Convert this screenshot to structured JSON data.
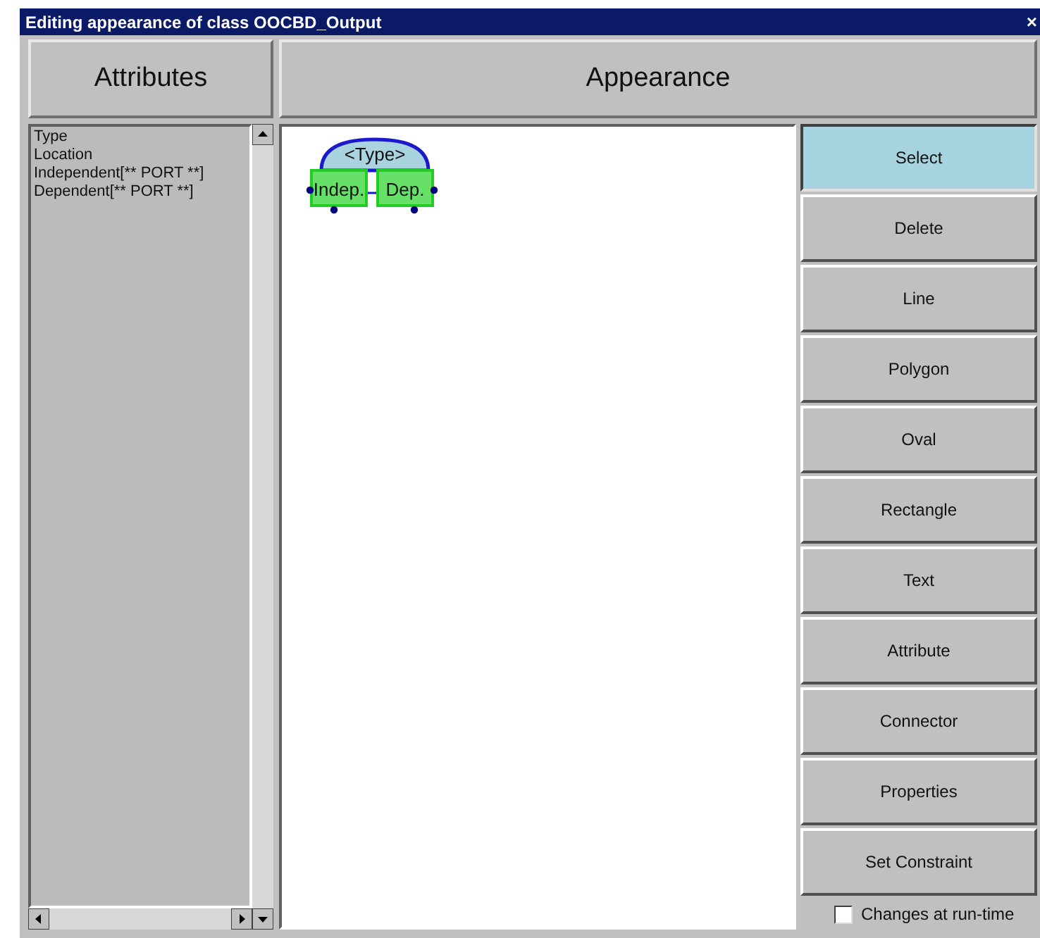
{
  "window": {
    "title": "Editing appearance of class OOCBD_Output",
    "close": "×"
  },
  "headers": {
    "left": "Attributes",
    "right": "Appearance"
  },
  "attributes": [
    "Type",
    "Location",
    "Independent[** PORT **]",
    "Dependent[** PORT **]"
  ],
  "canvas": {
    "type_label": "<Type>",
    "ports": [
      "Indep.",
      "Dep."
    ]
  },
  "tools": [
    {
      "label": "Select",
      "selected": true
    },
    {
      "label": "Delete",
      "selected": false
    },
    {
      "label": "Line",
      "selected": false
    },
    {
      "label": "Polygon",
      "selected": false
    },
    {
      "label": "Oval",
      "selected": false
    },
    {
      "label": "Rectangle",
      "selected": false
    },
    {
      "label": "Text",
      "selected": false
    },
    {
      "label": "Attribute",
      "selected": false
    },
    {
      "label": "Connector",
      "selected": false
    },
    {
      "label": "Properties",
      "selected": false
    },
    {
      "label": "Set Constraint",
      "selected": false
    }
  ],
  "runtime": {
    "label": "Changes at run-time",
    "checked": false
  }
}
